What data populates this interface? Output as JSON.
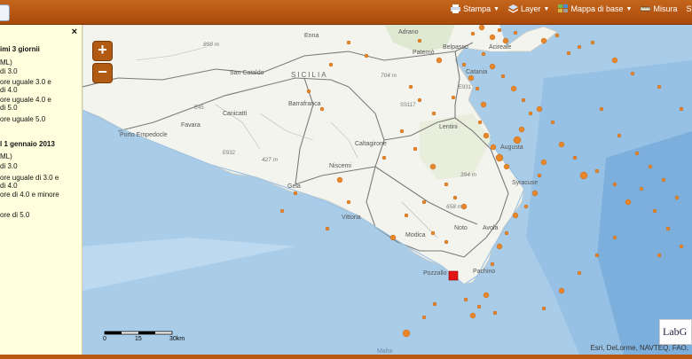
{
  "toolbar": {
    "items": [
      {
        "label": "Stampa",
        "icon": "print-icon"
      },
      {
        "label": "Layer",
        "icon": "layers-icon"
      },
      {
        "label": "Mappa di base",
        "icon": "basemap-icon"
      },
      {
        "label": "Misura",
        "icon": "measure-icon"
      }
    ],
    "overflow": "Sc"
  },
  "panel": {
    "close": "×",
    "section1": {
      "title": "imi 3 giornii",
      "items": [
        "ML)",
        "di 3.0",
        "ore uguale 3.0 e\n di 4.0",
        "ore uguale 4.0 e\n di 5.0",
        "ore uguale 5.0"
      ]
    },
    "section2": {
      "title": "l 1 gennaio 2013",
      "items": [
        "ML)",
        "di 3.0",
        "ore uguale di 3.0 e\n di 4.0",
        "ore di 4.0 e minore",
        "ore di 5.0"
      ]
    }
  },
  "map": {
    "zoom_in": "+",
    "zoom_out": "−",
    "region_label": "SICILIA",
    "places": [
      "Adrano",
      "Belpasso",
      "Acireale",
      "Paternò",
      "Catania",
      "Enna",
      "San Cataldo",
      "Barrafranca",
      "Canicattì",
      "Favara",
      "Porto Empedocle",
      "Caltagirone",
      "Lentini",
      "Augusta",
      "Niscemi",
      "Gela",
      "Syracuse",
      "Vittoria",
      "Modica",
      "Noto",
      "Avola",
      "Pozzallo",
      "Pachino",
      "Malta"
    ],
    "elevations": [
      "898 m",
      "704 m",
      "427 m",
      "394 m",
      "658 m"
    ],
    "roads": [
      "E45",
      "SS117",
      "E932",
      "E931"
    ],
    "scale": {
      "zero": "0",
      "mid": "15",
      "end": "30km"
    },
    "attribution": "Esri, DeLorme, NAVTEQ, FAO,",
    "logo": "LabG",
    "colors": {
      "sea": "#a9cde9",
      "land": "#f4f4ee",
      "quake": "#e8862a",
      "marker": "#e31414"
    }
  }
}
